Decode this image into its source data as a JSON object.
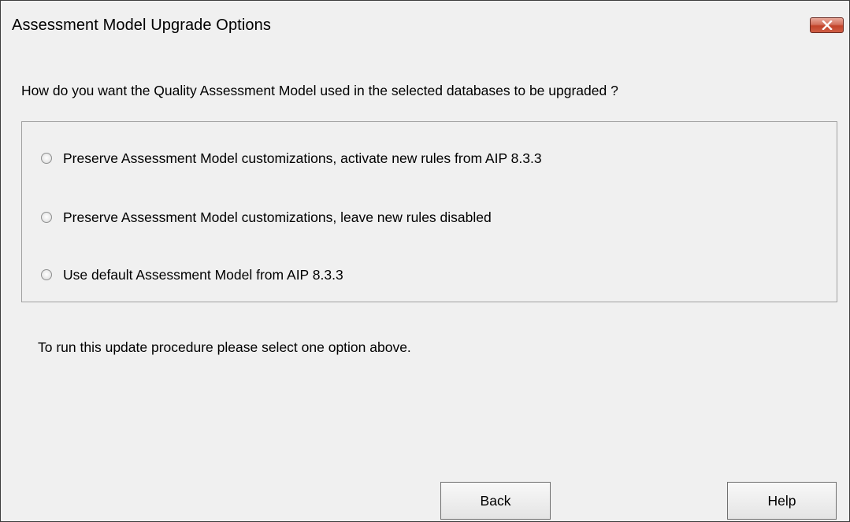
{
  "window": {
    "title": "Assessment Model Upgrade Options",
    "close_icon": "close-icon",
    "close_button_color": "#c2432a"
  },
  "question": "How do you want the Quality Assessment Model used in the selected databases to be upgraded ?",
  "options": [
    {
      "label": "Preserve Assessment Model customizations, activate new rules from AIP 8.3.3",
      "selected": false
    },
    {
      "label": "Preserve Assessment Model customizations, leave new rules disabled",
      "selected": false
    },
    {
      "label": "Use default Assessment Model from AIP 8.3.3",
      "selected": false
    }
  ],
  "hint": "To run this update procedure please select one option above.",
  "buttons": {
    "back": "Back",
    "help": "Help"
  }
}
